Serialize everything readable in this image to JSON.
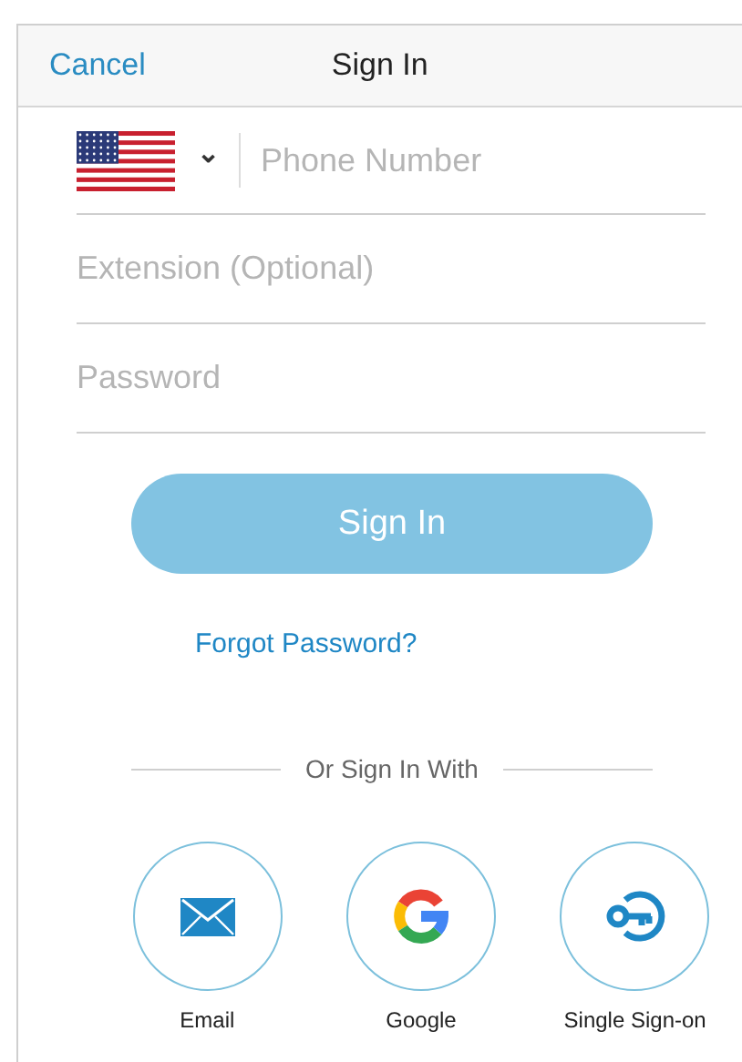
{
  "header": {
    "cancel": "Cancel",
    "title": "Sign In"
  },
  "phone": {
    "country_caret": "⌄",
    "placeholder": "Phone Number"
  },
  "fields": [
    {
      "placeholder": "Extension (Optional)"
    },
    {
      "placeholder": "Password"
    }
  ],
  "sign_in_button": {
    "label": "Sign In",
    "disabled": true
  },
  "forgot_link": "Forgot Password?",
  "divider_label": "Or Sign In With",
  "providers": [
    {
      "kind": "email",
      "label": "Email"
    },
    {
      "kind": "google",
      "label": "Google"
    },
    {
      "kind": "sso",
      "label": "Single Sign-on"
    }
  ]
}
